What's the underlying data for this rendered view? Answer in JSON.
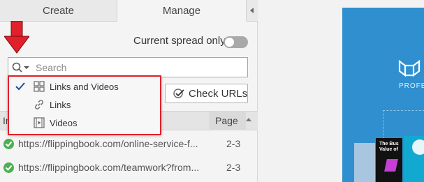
{
  "tabs": {
    "create": "Create",
    "manage": "Manage"
  },
  "toggle": {
    "label": "Current spread only",
    "on": false
  },
  "search": {
    "placeholder": "Search"
  },
  "filter_menu": {
    "items": [
      {
        "label": "Links and Videos",
        "checked": true,
        "icon": "grid-icon"
      },
      {
        "label": "Links",
        "checked": false,
        "icon": "link-icon"
      },
      {
        "label": "Videos",
        "checked": false,
        "icon": "video-icon"
      }
    ]
  },
  "check_urls": {
    "label": "Check URLs"
  },
  "table": {
    "col_link": "In",
    "col_page": "Page",
    "rows": [
      {
        "url": "https://flippingbook.com/online-service-f...",
        "page": "2-3",
        "status": "ok"
      },
      {
        "url": "https://flippingbook.com/teamwork?from...",
        "page": "2-3",
        "status": "ok"
      }
    ]
  },
  "preview": {
    "brand": "PROFES",
    "thumb_text": "The Bus\nValue of"
  },
  "colors": {
    "highlight_red": "#e0202a",
    "accent_blue": "#2f8fcf",
    "ok_green": "#4caf50"
  }
}
